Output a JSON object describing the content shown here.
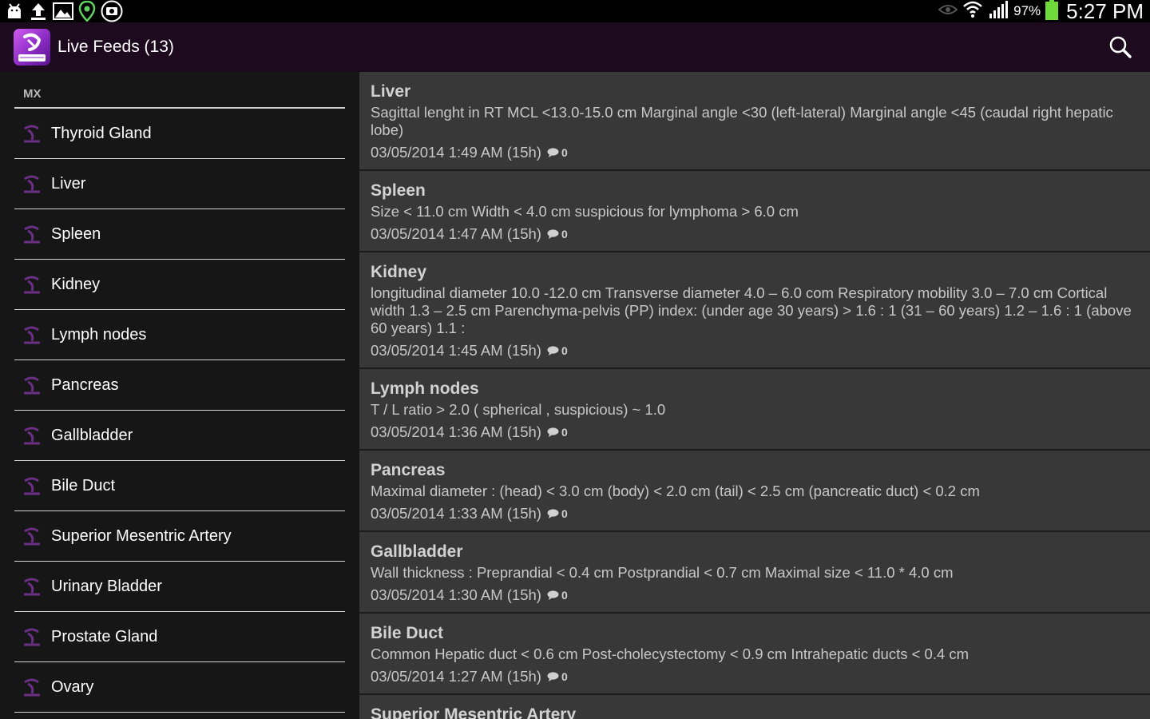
{
  "status": {
    "battery": "97%",
    "time": "5:27 PM",
    "icons": [
      "android-icon",
      "upload-icon",
      "gallery-icon",
      "location-pin-icon",
      "camera-icon",
      "eye-icon",
      "wifi-icon",
      "signal-icon",
      "battery-icon"
    ]
  },
  "actionbar": {
    "title": "Live Feeds (13)",
    "icons": [
      "app-logo-icon",
      "search-icon"
    ]
  },
  "colors": {
    "actionbar": "#1d0a1f",
    "drawer": "#161616",
    "feed": "#383838",
    "accent": "#8a2bc4"
  },
  "drawer": {
    "header": "MX",
    "items": [
      "Thyroid Gland",
      "Liver",
      "Spleen",
      "Kidney",
      "Lymph nodes",
      "Pancreas",
      "Gallbladder",
      "Bile Duct",
      "Superior Mesentric Artery",
      "Urinary Bladder",
      "Prostate Gland",
      "Ovary"
    ]
  },
  "feed": [
    {
      "title": "Liver",
      "body": "Sagittal lenght in RT MCL  <13.0-15.0 cm Marginal angle <30 (left-lateral) Marginal angle <45 (caudal right hepatic lobe)",
      "date": "03/05/2014 1:49 AM (15h)",
      "comments": "0"
    },
    {
      "title": "Spleen",
      "body": "Size  < 11.0 cm Width < 4.0 cm suspicious for lymphoma > 6.0 cm",
      "date": "03/05/2014 1:47 AM (15h)",
      "comments": "0"
    },
    {
      "title": "Kidney",
      "body": "longitudinal diameter 10.0 -12.0 cm Transverse diameter 4.0 – 6.0 com Respiratory mobility 3.0 – 7.0 cm Cortical width 1.3 – 2.5 cm Parenchyma-pelvis (PP) index: (under age 30 years) > 1.6 : 1 (31 – 60 years) 1.2 – 1.6 : 1 (above 60 years) 1.1 :",
      "date": "03/05/2014 1:45 AM (15h)",
      "comments": "0"
    },
    {
      "title": "Lymph nodes",
      "body": "T / L ratio > 2.0 ( spherical , suspicious) ~ 1.0",
      "date": "03/05/2014 1:36 AM (15h)",
      "comments": "0"
    },
    {
      "title": "Pancreas",
      "body": "Maximal diameter : (head) < 3.0 cm (body) < 2.0 cm (tail) < 2.5 cm (pancreatic duct) < 0.2 cm",
      "date": "03/05/2014 1:33 AM (15h)",
      "comments": "0"
    },
    {
      "title": "Gallbladder",
      "body": "Wall thickness : Preprandial < 0.4 cm Postprandial < 0.7 cm   Maximal size < 11.0 * 4.0 cm",
      "date": "03/05/2014 1:30 AM (15h)",
      "comments": "0"
    },
    {
      "title": "Bile Duct",
      "body": "Common Hepatic duct < 0.6 cm   Post-cholecystectomy < 0.9 cm   Intrahepatic ducts < 0.4 cm",
      "date": "03/05/2014 1:27 AM (15h)",
      "comments": "0"
    },
    {
      "title": "Superior Mesentric Artery",
      "body": "",
      "date": "",
      "comments": ""
    }
  ]
}
